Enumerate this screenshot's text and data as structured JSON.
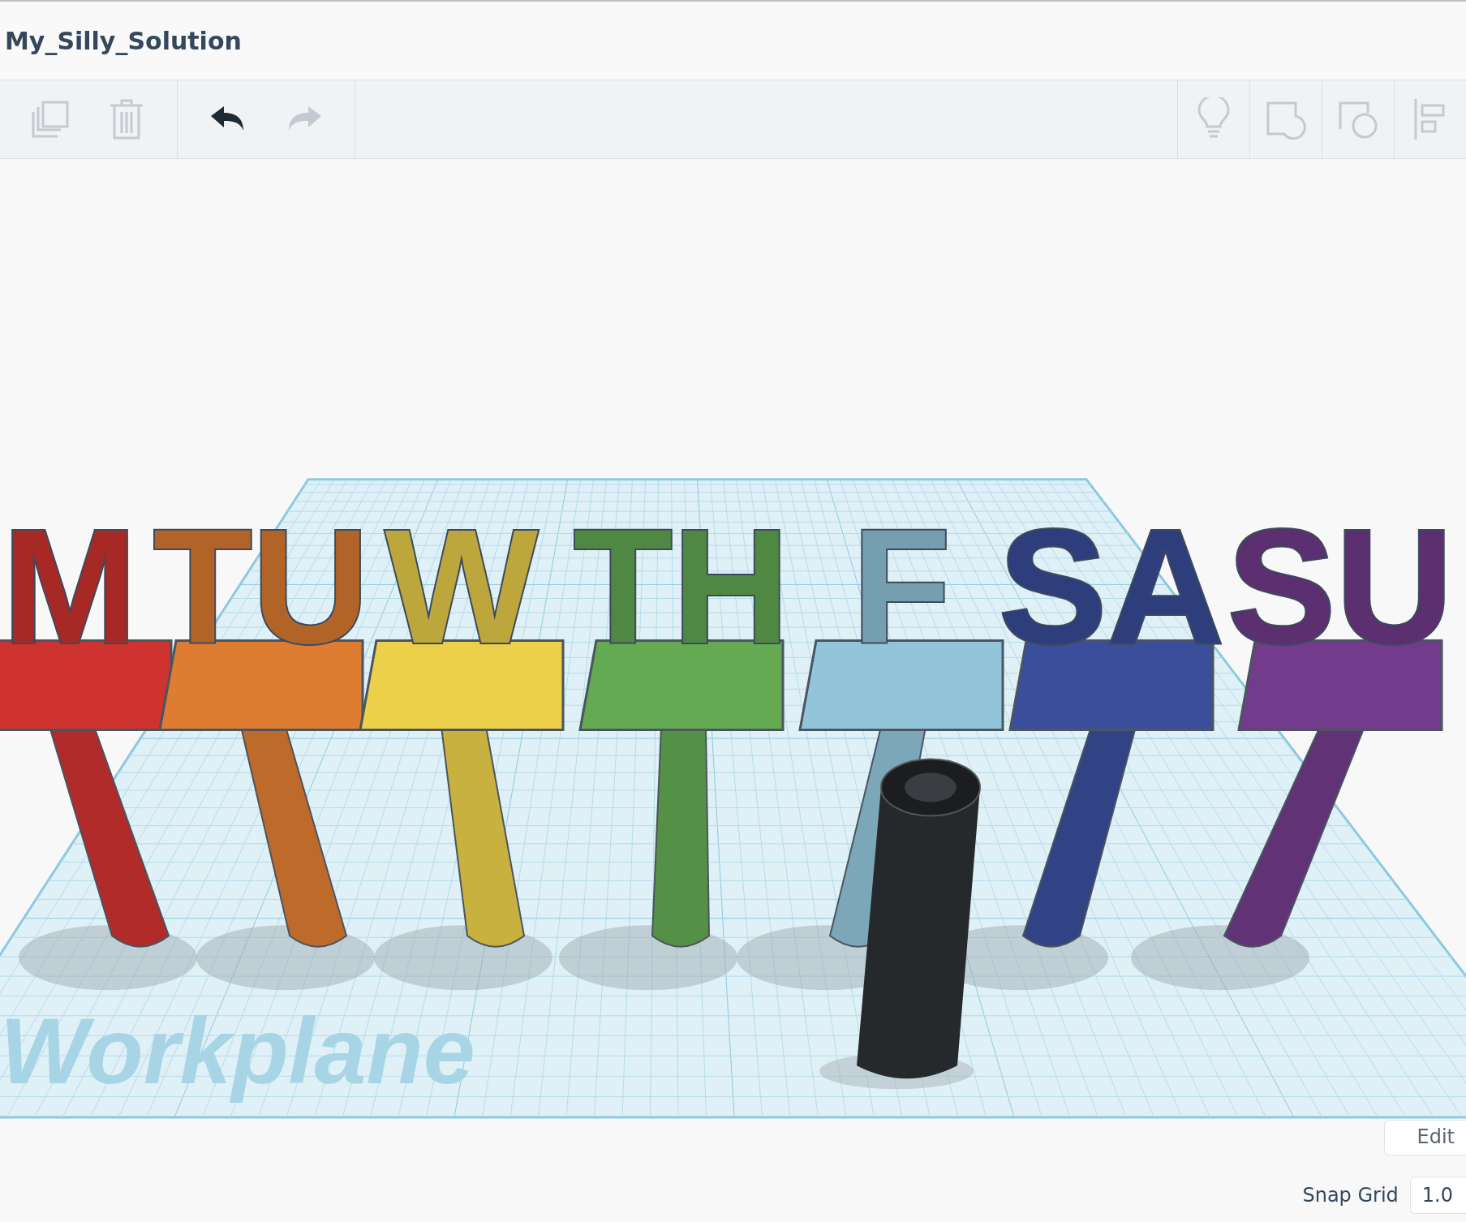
{
  "title": "My_Silly_Solution",
  "toolbar": {
    "left": [
      {
        "kind": "copy",
        "disabled": true
      },
      {
        "kind": "trash",
        "disabled": true
      },
      {
        "kind": "undo",
        "disabled": false
      },
      {
        "kind": "redo",
        "disabled": true
      }
    ],
    "right": [
      {
        "kind": "bulb",
        "disabled": true
      },
      {
        "kind": "note",
        "disabled": true
      },
      {
        "kind": "shape",
        "disabled": true
      },
      {
        "kind": "align",
        "disabled": true
      }
    ]
  },
  "scene": {
    "objects": [
      {
        "label": "M",
        "color": "#cf3330"
      },
      {
        "label": "TU",
        "color": "#de7d32"
      },
      {
        "label": "W",
        "color": "#ecd04a"
      },
      {
        "label": "TH",
        "color": "#63aa52"
      },
      {
        "label": "F",
        "color": "#92c5da"
      },
      {
        "label": "SA",
        "color": "#3a4e9c"
      },
      {
        "label": "SU",
        "color": "#733b8c"
      }
    ],
    "workplane_label": "Workplane"
  },
  "grid_controls": {
    "edit_button": "Edit",
    "snap_label": "Snap Grid",
    "snap_value": "1.0"
  }
}
